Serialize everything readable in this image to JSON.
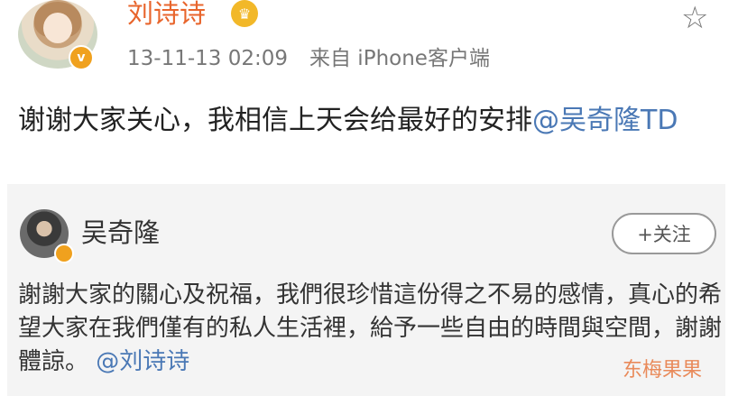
{
  "post": {
    "author": "刘诗诗",
    "verified_badge": "v",
    "member_icon": "crown-icon",
    "timestamp": "13-11-13 02:09",
    "source": "来自 iPhone客户端",
    "text": "谢谢大家关心，我相信上天会给最好的安排",
    "mention": "@吴奇隆TD"
  },
  "repost": {
    "author": "吴奇隆",
    "follow_label": "+关注",
    "text": "謝謝大家的關心及祝福，我們很珍惜這份得之不易的感情，真心的希望大家在我們僅有的私人生活裡，給予一些自由的時間與空間，謝謝體諒。",
    "mention": "@刘诗诗"
  },
  "watermark": "东梅果果",
  "icons": {
    "favorite": "star-outline-icon"
  },
  "colors": {
    "author_name": "#e8652c",
    "mention": "#4a78b5",
    "badge": "#f0a11e"
  }
}
